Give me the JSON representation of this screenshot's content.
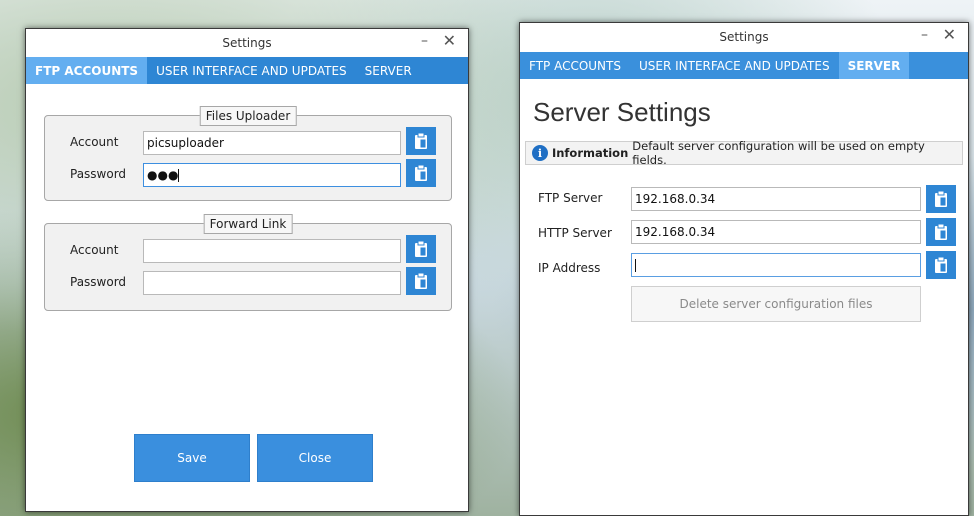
{
  "window_left": {
    "title": "Settings",
    "min_glyph": "–",
    "close_glyph": "✕",
    "tabs": [
      {
        "label": "FTP ACCOUNTS",
        "active": true
      },
      {
        "label": "USER INTERFACE AND UPDATES",
        "active": false
      },
      {
        "label": "SERVER",
        "active": false
      }
    ],
    "groups": [
      {
        "legend": "Files Uploader",
        "fields": [
          {
            "label": "Account",
            "value": "picsuploader"
          },
          {
            "label": "Password",
            "value": "●●●"
          }
        ]
      },
      {
        "legend": "Forward Link",
        "fields": [
          {
            "label": "Account",
            "value": ""
          },
          {
            "label": "Password",
            "value": ""
          }
        ]
      }
    ],
    "buttons": {
      "save": "Save",
      "close": "Close"
    }
  },
  "window_right": {
    "title": "Settings",
    "min_glyph": "–",
    "close_glyph": "✕",
    "tabs": [
      {
        "label": "FTP ACCOUNTS",
        "active": false
      },
      {
        "label": "USER INTERFACE AND UPDATES",
        "active": false
      },
      {
        "label": "SERVER",
        "active": true
      }
    ],
    "heading": "Server Settings",
    "info": {
      "icon": "i",
      "label": "Information",
      "text": "Default server configuration will be used on empty fields."
    },
    "fields": [
      {
        "label": "FTP Server",
        "value": "192.168.0.34"
      },
      {
        "label": "HTTP Server",
        "value": "192.168.0.34"
      },
      {
        "label": "IP Address",
        "value": ""
      }
    ],
    "delete_button": "Delete server configuration files"
  },
  "icons": {
    "clipboard": "clipboard-paste-icon",
    "info": "info-icon"
  },
  "colors": {
    "accent": "#2e86d4",
    "active_tab": "#63aef0"
  }
}
